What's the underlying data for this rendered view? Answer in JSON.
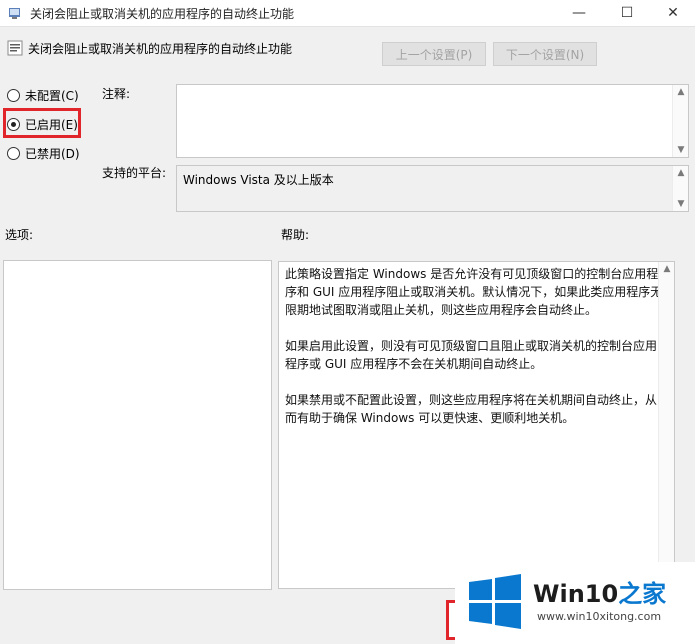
{
  "window": {
    "title": "关闭会阻止或取消关机的应用程序的自动终止功能",
    "controls": {
      "minimize": "—",
      "maximize": "☐",
      "close": "✕"
    }
  },
  "header": {
    "title": "关闭会阻止或取消关机的应用程序的自动终止功能",
    "prev_button": "上一个设置(P)",
    "next_button": "下一个设置(N)"
  },
  "options": {
    "not_configured": "未配置(C)",
    "enabled": "已启用(E)",
    "disabled": "已禁用(D)",
    "selected": "enabled"
  },
  "comment": {
    "label": "注释:",
    "value": ""
  },
  "platform": {
    "label": "支持的平台:",
    "value": "Windows Vista 及以上版本"
  },
  "options_section": {
    "label": "选项:"
  },
  "help_section": {
    "label": "帮助:",
    "paragraphs": [
      "此策略设置指定 Windows 是否允许没有可见顶级窗口的控制台应用程序和 GUI 应用程序阻止或取消关机。默认情况下，如果此类应用程序无限期地试图取消或阻止关机，则这些应用程序会自动终止。",
      "如果启用此设置，则没有可见顶级窗口且阻止或取消关机的控制台应用程序或 GUI 应用程序不会在关机期间自动终止。",
      "如果禁用或不配置此设置，则这些应用程序将在关机期间自动终止，从而有助于确保 Windows 可以更快速、更顺利地关机。"
    ]
  },
  "watermark": {
    "brand_main": "Win10",
    "brand_accent": "之家",
    "url": "www.win10xitong.com"
  },
  "colors": {
    "highlight": "#e0262a",
    "windows_blue": "#0a78cf"
  }
}
